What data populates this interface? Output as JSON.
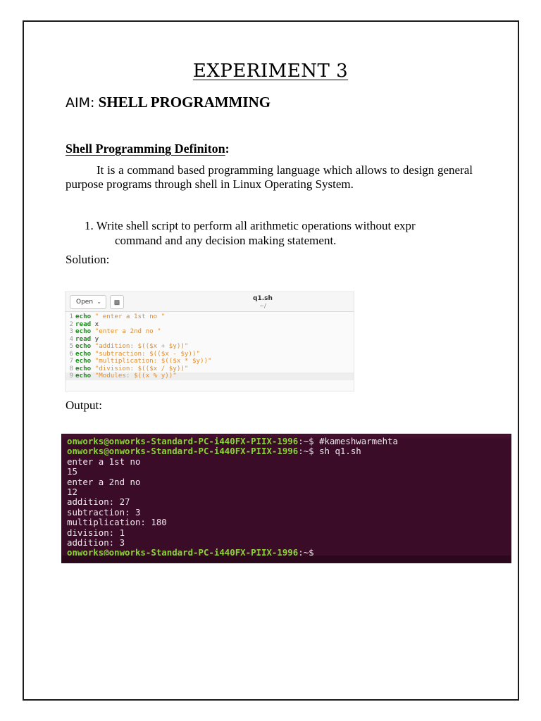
{
  "heading": {
    "title": "EXPERIMENT 3",
    "aim_label": "AIM:",
    "aim_text": "SHELL PROGRAMMING"
  },
  "definition": {
    "heading": "Shell Programming Definiton",
    "colon": ":",
    "paragraph": "It is a command based programming language which allows to design general purpose programs through shell in Linux Operating System."
  },
  "question": {
    "number": "1.",
    "line1": "Write shell script to perform all arithmetic operations without expr",
    "line2": "command and any decision making statement."
  },
  "labels": {
    "solution": "Solution:",
    "output": "Output:"
  },
  "editor": {
    "open_button": "Open",
    "file_name": "q1.sh",
    "file_path": "~/",
    "lines": [
      {
        "n": "1",
        "kw": "echo",
        "rest": "\" enter a 1st no \""
      },
      {
        "n": "2",
        "kw": "read",
        "rest": "x"
      },
      {
        "n": "3",
        "kw": "echo",
        "rest": "\"enter a 2nd no \""
      },
      {
        "n": "4",
        "kw": "read",
        "rest": "y"
      },
      {
        "n": "5",
        "kw": "echo",
        "rest": "\"addition: $(($x + $y))\""
      },
      {
        "n": "6",
        "kw": "echo",
        "rest": "\"subtraction: $(($x - $y))\""
      },
      {
        "n": "7",
        "kw": "echo",
        "rest": "\"multiplication: $(($x * $y))\""
      },
      {
        "n": "8",
        "kw": "echo",
        "rest": "\"division: $(($x / $y))\""
      },
      {
        "n": "9",
        "kw": "echo",
        "rest": "\"Modules: $((x % y))\""
      }
    ]
  },
  "terminal": {
    "lines": [
      {
        "prompt": "onworks@onworks-Standard-PC-i440FX-PIIX-1996",
        "sep": ":~$ ",
        "text": "#kameshwarmehta"
      },
      {
        "prompt": "onworks@onworks-Standard-PC-i440FX-PIIX-1996",
        "sep": ":~$ ",
        "text": "sh q1.sh"
      },
      {
        "prompt": "",
        "sep": "",
        "text": "enter a 1st no"
      },
      {
        "prompt": "",
        "sep": "",
        "text": "15"
      },
      {
        "prompt": "",
        "sep": "",
        "text": "enter a 2nd no"
      },
      {
        "prompt": "",
        "sep": "",
        "text": "12"
      },
      {
        "prompt": "",
        "sep": "",
        "text": "addition: 27"
      },
      {
        "prompt": "",
        "sep": "",
        "text": "subtraction: 3"
      },
      {
        "prompt": "",
        "sep": "",
        "text": "multiplication: 180"
      },
      {
        "prompt": "",
        "sep": "",
        "text": "division: 1"
      },
      {
        "prompt": "",
        "sep": "",
        "text": "addition: 3"
      },
      {
        "prompt": "onworks@onworks-Standard-PC-i440FX-PIIX-1996",
        "sep": ":~$",
        "text": ""
      }
    ]
  },
  "colors": {
    "terminal_bg": "#3a0c27",
    "prompt_green": "#8ad436",
    "keyword_green": "#1f8a1f",
    "string_orange": "#e08d2c"
  }
}
